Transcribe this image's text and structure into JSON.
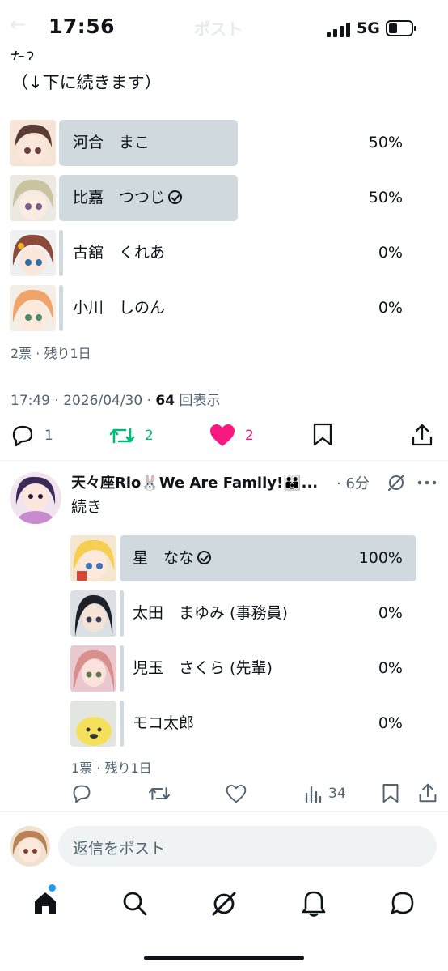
{
  "status_bar": {
    "time": "17:56",
    "network": "5G"
  },
  "header": {
    "title": "ポスト"
  },
  "post1": {
    "text_fragment": "た？",
    "text_continue": "（↓下に続きます）",
    "poll": {
      "options": [
        {
          "label": "河合　まこ",
          "percent": "50%",
          "value": 50,
          "selected": false
        },
        {
          "label": "比嘉　つつじ",
          "percent": "50%",
          "value": 50,
          "selected": true
        },
        {
          "label": "古舘　くれあ",
          "percent": "0%",
          "value": 0,
          "selected": false
        },
        {
          "label": "小川　しのん",
          "percent": "0%",
          "value": 0,
          "selected": false
        }
      ],
      "summary": "2票 · 残り1日"
    },
    "timestamp": "17:49 · 2026/04/30 · ",
    "views_count": "64",
    "views_label": " 回表示",
    "actions": {
      "replies": "1",
      "reposts": "2",
      "likes": "2"
    }
  },
  "post2": {
    "author_name": "天々座Rio🐰We Are Family!👪...",
    "time_ago": "· 6分",
    "text": "続き",
    "poll": {
      "options": [
        {
          "label": "星　なな",
          "percent": "100%",
          "value": 100,
          "selected": true
        },
        {
          "label": "太田　まゆみ (事務員)",
          "percent": "0%",
          "value": 0,
          "selected": false
        },
        {
          "label": "児玉　さくら (先輩)",
          "percent": "0%",
          "value": 0,
          "selected": false
        },
        {
          "label": "モコ太郎",
          "percent": "0%",
          "value": 0,
          "selected": false
        }
      ],
      "summary": "1票 · 残り1日"
    },
    "actions": {
      "views": "34"
    }
  },
  "reply_bar": {
    "placeholder": "返信をポスト"
  },
  "colors": {
    "accent": "#1d9bf0",
    "repost_green": "#00ba7c",
    "like_pink": "#f91880",
    "poll_bar": "#cfd9de",
    "muted": "#536471"
  },
  "tabbar": {
    "items": [
      "home-icon",
      "search-icon",
      "grok-icon",
      "bell-icon",
      "messages-icon"
    ]
  }
}
